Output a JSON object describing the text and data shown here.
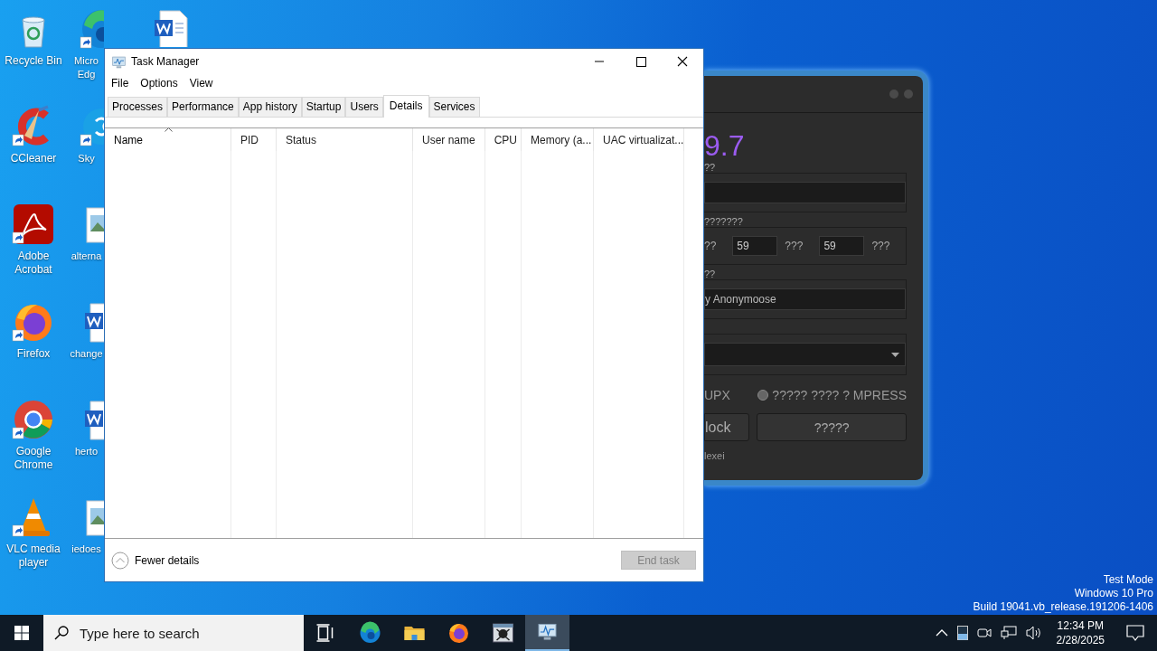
{
  "desktop_icon_columns": [
    {
      "icons": [
        {
          "kind": "recycle",
          "shortcut": false,
          "lines": [
            "Recycle Bin"
          ]
        },
        {
          "kind": "ccleaner",
          "shortcut": true,
          "lines": [
            "CCleaner"
          ]
        },
        {
          "kind": "acrobat",
          "shortcut": true,
          "lines": [
            "Adobe",
            "Acrobat"
          ]
        },
        {
          "kind": "firefox",
          "shortcut": true,
          "lines": [
            "Firefox"
          ]
        },
        {
          "kind": "chrome",
          "shortcut": true,
          "lines": [
            "Google",
            "Chrome"
          ]
        },
        {
          "kind": "vlc",
          "shortcut": true,
          "lines": [
            "VLC media",
            "player"
          ]
        }
      ]
    },
    {
      "icons": [
        {
          "kind": "edge",
          "shortcut": true,
          "lines": [
            "Micro",
            "Edg"
          ]
        },
        {
          "kind": "skype",
          "shortcut": true,
          "lines": [
            "Sky"
          ]
        },
        {
          "kind": "image",
          "shortcut": false,
          "lines": [
            "alterna"
          ]
        },
        {
          "kind": "word",
          "shortcut": false,
          "lines": [
            "change"
          ]
        },
        {
          "kind": "word",
          "shortcut": false,
          "lines": [
            "herto"
          ]
        },
        {
          "kind": "image",
          "shortcut": false,
          "lines": [
            "iedoes"
          ]
        }
      ]
    },
    {
      "icons": [
        {
          "kind": "word",
          "shortcut": false
        }
      ]
    }
  ],
  "background_app": {
    "version": "9.7",
    "path_label": "??",
    "time_label": "???????",
    "time_unit_1": "??",
    "minutes": "59",
    "time_unit_2": "???",
    "seconds": "59",
    "time_unit_3": "???",
    "author_label": "??",
    "author_value": "y Anonymoose",
    "packer_label": "UPX",
    "radio": {
      "label": "????? ???? ? MPRESS",
      "selected": false
    },
    "buttons": [
      "lock",
      "?????"
    ],
    "footer_text": "lexei"
  },
  "task_manager": {
    "title": "Task Manager",
    "menu": [
      "File",
      "Options",
      "View"
    ],
    "tabs": [
      {
        "label": "Processes",
        "selected": false
      },
      {
        "label": "Performance",
        "selected": false
      },
      {
        "label": "App history",
        "selected": false
      },
      {
        "label": "Startup",
        "selected": false
      },
      {
        "label": "Users",
        "selected": false
      },
      {
        "label": "Details",
        "selected": true
      },
      {
        "label": "Services",
        "selected": false
      }
    ],
    "columns": [
      {
        "label": "Name",
        "sorted": true
      },
      {
        "label": "PID",
        "sorted": false
      },
      {
        "label": "Status",
        "sorted": false
      },
      {
        "label": "User name",
        "sorted": false
      },
      {
        "label": "CPU",
        "sorted": false
      },
      {
        "label": "Memory (a...",
        "sorted": false
      },
      {
        "label": "UAC virtualizat...",
        "sorted": false
      }
    ],
    "footer": {
      "toggle": "Fewer details",
      "end_task": {
        "label": "End task",
        "disabled": true
      }
    }
  },
  "system_watermark": [
    "Test Mode",
    "Windows 10 Pro",
    "Build 19041.vb_release.191206-1406"
  ],
  "taskbar": {
    "search": {
      "placeholder": "Type here to search"
    },
    "apps": [
      {
        "kind": "task-view",
        "active": false
      },
      {
        "kind": "edge",
        "active": false
      },
      {
        "kind": "folder",
        "active": false
      },
      {
        "kind": "firefox",
        "active": false
      },
      {
        "kind": "skull",
        "active": false
      },
      {
        "kind": "task-manager",
        "active": true
      }
    ],
    "clock": {
      "time": "12:34 PM",
      "date": "2/28/2025"
    }
  }
}
